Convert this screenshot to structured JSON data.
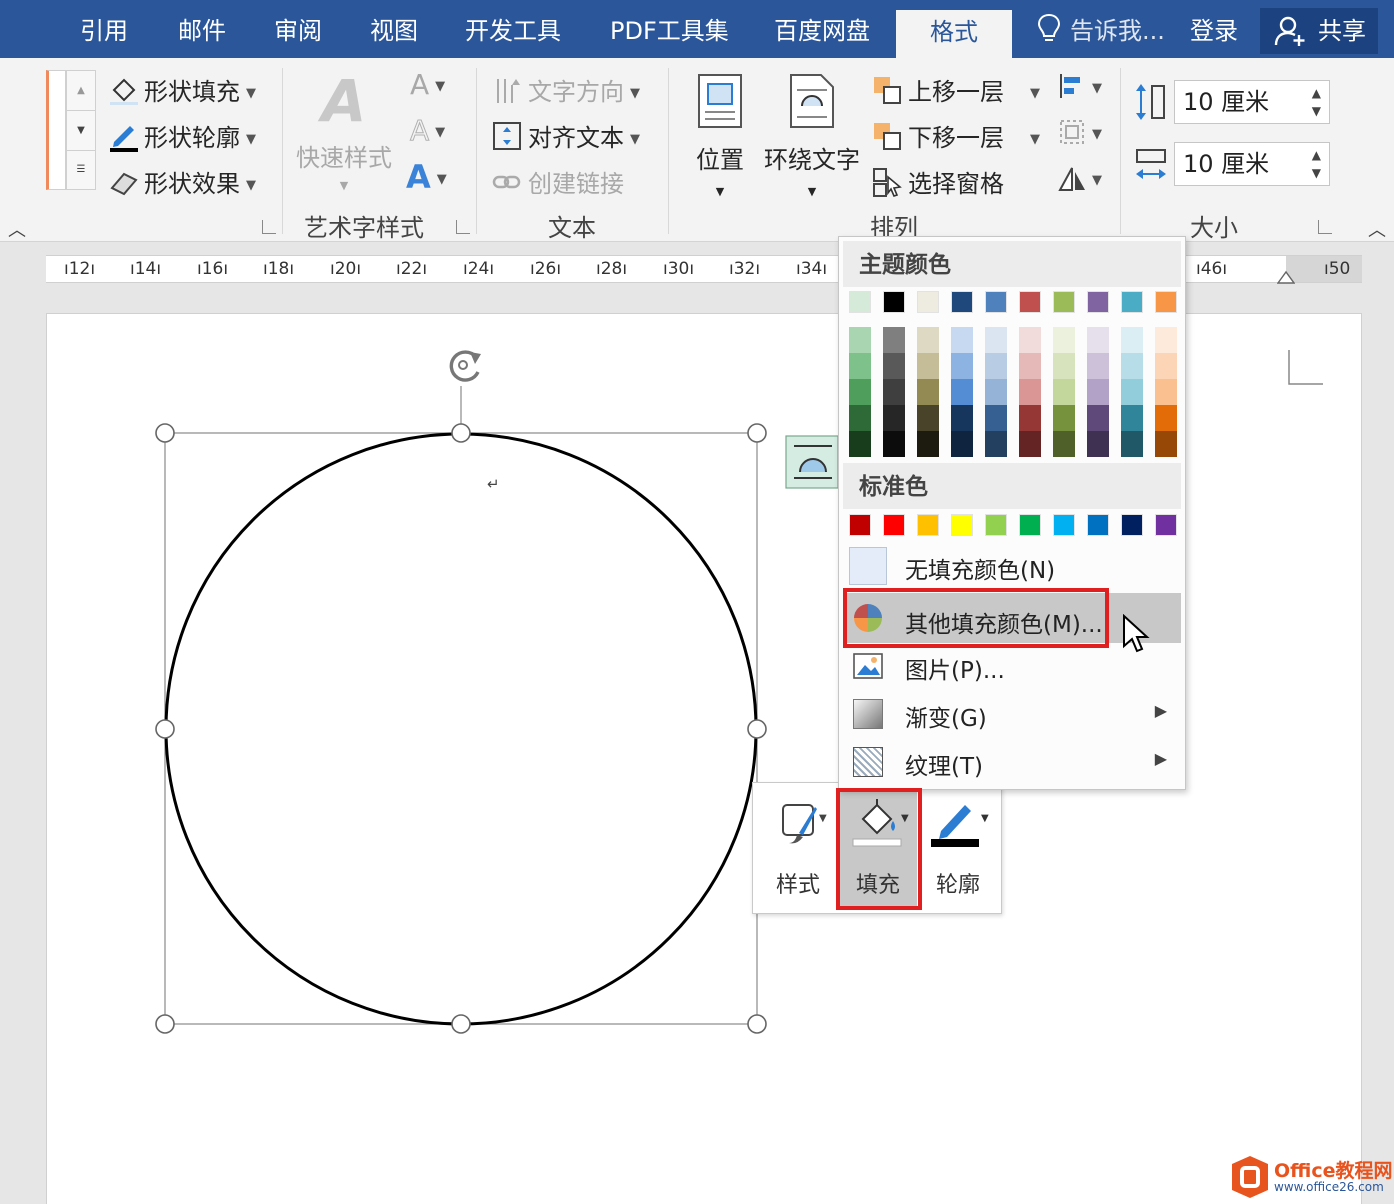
{
  "tabs": [
    {
      "label": "引用"
    },
    {
      "label": "邮件"
    },
    {
      "label": "审阅"
    },
    {
      "label": "视图"
    },
    {
      "label": "开发工具"
    },
    {
      "label": "PDF工具集"
    },
    {
      "label": "百度网盘"
    },
    {
      "label": "格式",
      "active": true
    }
  ],
  "tell_me": "告诉我...",
  "login": "登录",
  "share": "共享",
  "ribbon": {
    "shape_styles": {
      "fill": "形状填充",
      "outline": "形状轮廓",
      "effects": "形状效果"
    },
    "wordart": {
      "quick_styles": "快速样式",
      "group_label": "艺术字样式",
      "letter": "A"
    },
    "text": {
      "direction": "文字方向",
      "align": "对齐文本",
      "link": "创建链接",
      "group_label": "文本"
    },
    "arrange": {
      "position": "位置",
      "wrap": "环绕文字",
      "bring_forward": "上移一层",
      "send_backward": "下移一层",
      "selection_pane": "选择窗格",
      "group_label": "排列"
    },
    "size": {
      "height": "10 厘米",
      "width": "10 厘米",
      "group_label": "大小"
    }
  },
  "ruler_ticks": [
    "12",
    "14",
    "16",
    "18",
    "20",
    "22",
    "24",
    "26",
    "28",
    "30",
    "32",
    "34",
    "46",
    "50"
  ],
  "color_menu": {
    "theme_header": "主题颜色",
    "theme_top": [
      "#d5ead8",
      "#000000",
      "#eeece1",
      "#1f497d",
      "#4f81bd",
      "#c0504d",
      "#9bbb59",
      "#8064a2",
      "#4bacc6",
      "#f79646"
    ],
    "theme_shades": [
      [
        "#a9d6b1",
        "#7fc18a",
        "#4f9e5c",
        "#2e6a38",
        "#173d1d"
      ],
      [
        "#7f7f7f",
        "#595959",
        "#3f3f3f",
        "#262626",
        "#0c0c0c"
      ],
      [
        "#ddd9c3",
        "#c4bd97",
        "#938953",
        "#494429",
        "#1d1b10"
      ],
      [
        "#c6d9f0",
        "#8db3e2",
        "#548dd4",
        "#17365d",
        "#0f243e"
      ],
      [
        "#dbe5f1",
        "#b8cce4",
        "#95b3d7",
        "#366092",
        "#244061"
      ],
      [
        "#f2dcdb",
        "#e5b9b7",
        "#d99694",
        "#953734",
        "#632423"
      ],
      [
        "#ebf1dd",
        "#d7e3bc",
        "#c3d69b",
        "#76923c",
        "#4f6128"
      ],
      [
        "#e5e0ec",
        "#ccc1d9",
        "#b2a2c7",
        "#5f497a",
        "#3f3151"
      ],
      [
        "#dbeef3",
        "#b7dde8",
        "#92cddc",
        "#31859b",
        "#205867"
      ],
      [
        "#fdeada",
        "#fbd5b5",
        "#fac08f",
        "#e36c09",
        "#974806"
      ]
    ],
    "standard_header": "标准色",
    "standard": [
      "#c00000",
      "#ff0000",
      "#ffc000",
      "#ffff00",
      "#92d050",
      "#00b050",
      "#00b0f0",
      "#0070c0",
      "#002060",
      "#7030a0"
    ],
    "no_fill": "无填充颜色(N)",
    "more_colors": "其他填充颜色(M)...",
    "picture": "图片(P)...",
    "gradient": "渐变(G)",
    "texture": "纹理(T)"
  },
  "mini_toolbar": {
    "style": "样式",
    "fill": "填充",
    "outline": "轮廓"
  },
  "watermark": {
    "brand": "Office教程网",
    "url": "www.office26.com"
  }
}
